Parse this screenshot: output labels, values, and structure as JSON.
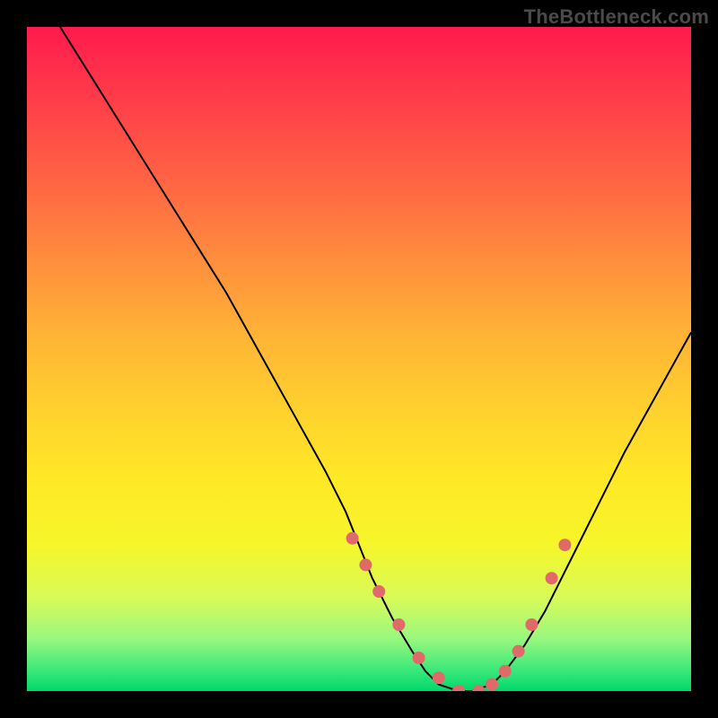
{
  "watermark": "TheBottleneck.com",
  "colors": {
    "background": "#000000",
    "dot": "#e06a6a",
    "curve": "#000000",
    "gradient_top": "#ff1a4d",
    "gradient_bottom": "#00d86a"
  },
  "chart_data": {
    "type": "line",
    "title": "",
    "xlabel": "",
    "ylabel": "",
    "xlim": [
      0,
      100
    ],
    "ylim": [
      0,
      100
    ],
    "grid": false,
    "legend": false,
    "series": [
      {
        "name": "bottleneck-curve",
        "x": [
          5,
          10,
          15,
          20,
          25,
          30,
          35,
          40,
          45,
          48,
          50,
          52,
          55,
          58,
          60,
          62,
          65,
          67,
          70,
          72,
          75,
          78,
          82,
          86,
          90,
          95,
          100
        ],
        "y": [
          100,
          92,
          84,
          76,
          68,
          60,
          51,
          42,
          33,
          27,
          22,
          17,
          11,
          6,
          3,
          1,
          0,
          0,
          1,
          3,
          7,
          12,
          20,
          28,
          36,
          45,
          54
        ]
      }
    ],
    "markers": {
      "name": "highlight-dots",
      "x": [
        49,
        51,
        53,
        56,
        59,
        62,
        65,
        68,
        70,
        72,
        74,
        76,
        79,
        81
      ],
      "y": [
        23,
        19,
        15,
        10,
        5,
        2,
        0,
        0,
        1,
        3,
        6,
        10,
        17,
        22
      ]
    }
  }
}
